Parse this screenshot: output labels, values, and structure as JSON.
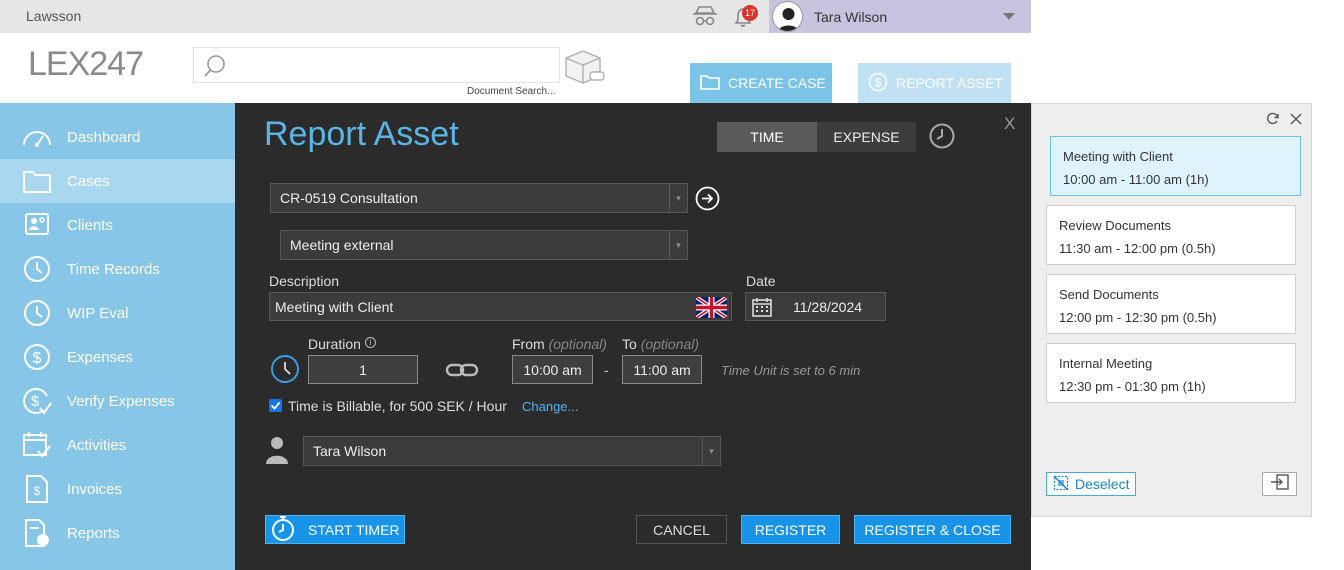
{
  "topbar": {
    "brand": "Lawsson",
    "notifications": "17",
    "user_name": "Tara Wilson"
  },
  "header": {
    "logo": "LEX247",
    "search_placeholder": "",
    "search_hint": "Document Search...",
    "create_case": "CREATE CASE",
    "report_asset": "REPORT ASSET"
  },
  "sidebar": {
    "items": [
      {
        "label": "Dashboard",
        "icon": "speedometer-icon"
      },
      {
        "label": "Cases",
        "icon": "folder-icon",
        "active": true
      },
      {
        "label": "Clients",
        "icon": "contacts-icon"
      },
      {
        "label": "Time Records",
        "icon": "clock-icon"
      },
      {
        "label": "WIP Eval",
        "icon": "clock-icon"
      },
      {
        "label": "Expenses",
        "icon": "dollar-circle-icon"
      },
      {
        "label": "Verify Expenses",
        "icon": "dollar-check-icon"
      },
      {
        "label": "Activities",
        "icon": "calendar-check-icon"
      },
      {
        "label": "Invoices",
        "icon": "invoice-icon"
      },
      {
        "label": "Reports",
        "icon": "report-icon"
      }
    ]
  },
  "form": {
    "title": "Report Asset",
    "tab_time": "TIME",
    "tab_expense": "EXPENSE",
    "close": "X",
    "case_value": "CR-0519 Consultation",
    "activity_value": "Meeting external",
    "description_label": "Description",
    "description_value": "Meeting with Client",
    "date_label": "Date",
    "date_value": "11/28/2024",
    "duration_label": "Duration",
    "duration_value": "1",
    "from_label": "From",
    "to_label": "To",
    "optional": "(optional)",
    "from_value": "10:00 am",
    "to_value": "11:00 am",
    "dash": "-",
    "time_unit_note": "Time Unit is set to 6 min",
    "billable_text": "Time is Billable, for 500 SEK / Hour",
    "billable_checked": true,
    "change_link": "Change...",
    "user_value": "Tara Wilson",
    "start_timer": "START TIMER",
    "cancel": "CANCEL",
    "register": "REGISTER",
    "register_close": "REGISTER & CLOSE"
  },
  "calendar": {
    "entries": [
      {
        "title": "Meeting with Client",
        "time": "10:00 am - 11:00 am (1h)",
        "selected": true
      },
      {
        "title": "Review Documents",
        "time": "11:30 am - 12:00 pm (0.5h)"
      },
      {
        "title": "Send Documents",
        "time": "12:00 pm - 12:30 pm (0.5h)"
      },
      {
        "title": "Internal Meeting",
        "time": "12:30 pm - 01:30 pm (1h)"
      }
    ],
    "deselect": "Deselect"
  },
  "colors": {
    "accent": "#5ab4e5",
    "sidebar": "#87c6e6",
    "panel": "#2b2b2b",
    "button": "#1794e8"
  }
}
